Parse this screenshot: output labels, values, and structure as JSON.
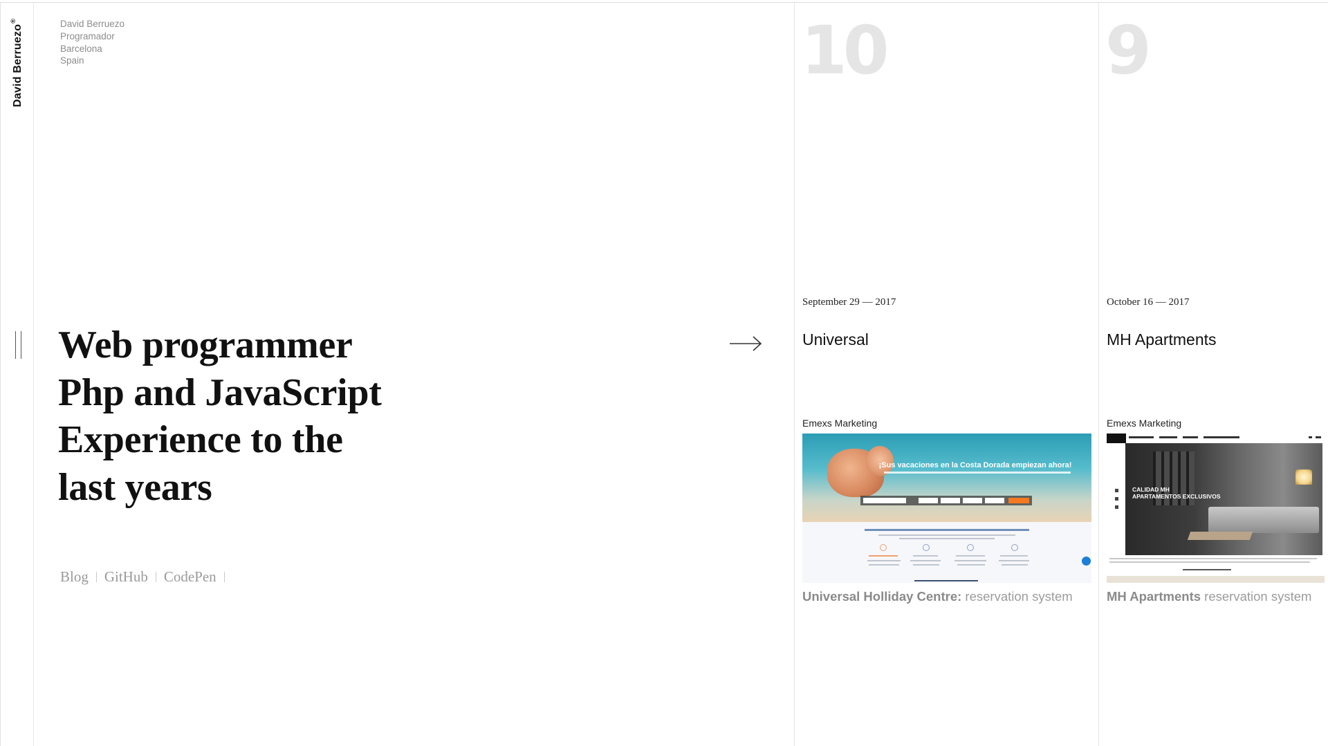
{
  "brand": {
    "name": "David Berruezo",
    "mark": "®"
  },
  "info": {
    "name": "David Berruezo",
    "role": "Programador",
    "city": "Barcelona",
    "country": "Spain"
  },
  "headline": {
    "lines": [
      "Web programmer",
      "Php and JavaScript",
      "Experience to the",
      "last years"
    ]
  },
  "links": [
    {
      "label": "Blog"
    },
    {
      "label": "GitHub"
    },
    {
      "label": "CodePen"
    }
  ],
  "icons": {
    "next": "arrow-right-icon",
    "rail": "double-bar-handle-icon"
  },
  "projects": [
    {
      "number": "10",
      "date": "September 29 — 2017",
      "title": "Universal",
      "client": "Emexs Marketing",
      "caption_bold": "Universal Holliday Centre:",
      "caption_rest": " reservation system",
      "thumbnail": {
        "headline": "¡Sus vacaciones en la Costa Dorada empiezan ahora!"
      }
    },
    {
      "number": "9",
      "date": "October 16 — 2017",
      "title": "MH Apartments",
      "client": "Emexs Marketing",
      "caption_bold": "MH Apartments",
      "caption_rest": " reservation system",
      "thumbnail": {
        "headline_1": "CALIDAD MH",
        "headline_2": "APARTAMENTOS EXCLUSIVOS"
      }
    }
  ],
  "colors": {
    "text": "#111111",
    "muted": "#8c8c8c",
    "number": "#e5e5e5",
    "divider": "#e6e6e6"
  }
}
